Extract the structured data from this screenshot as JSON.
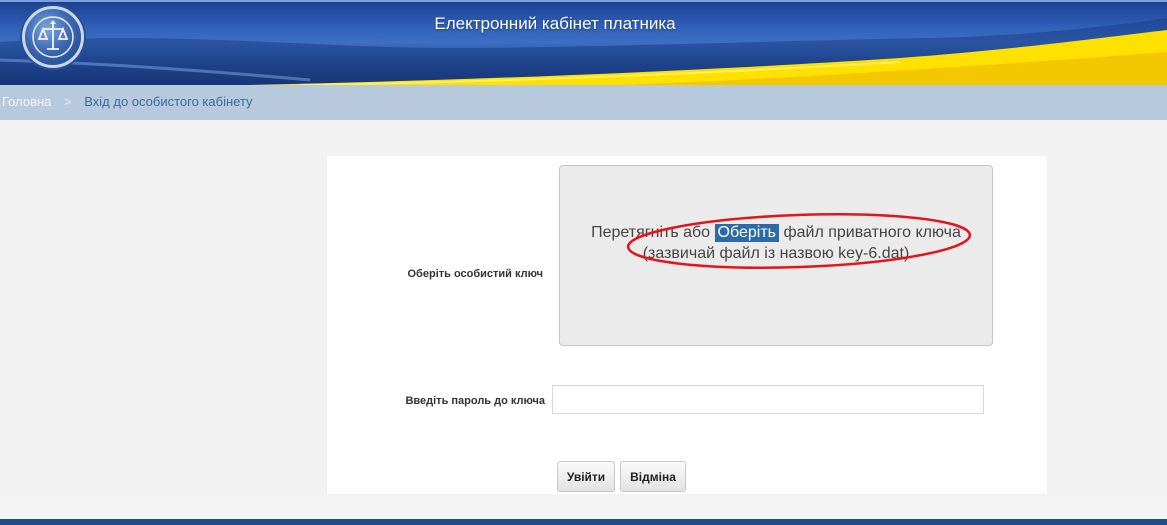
{
  "header": {
    "title": "Електронний кабінет платника",
    "flag_colors": {
      "blue": "#2f5fb8",
      "yellow": "#ffe100"
    },
    "emblem_icon": "tax-service-emblem-icon"
  },
  "breadcrumb": {
    "home": "Головна",
    "separator": ">",
    "current": "Вхід до особистого кабінету"
  },
  "form": {
    "key_label": "Оберіть особистий ключ",
    "dropzone": {
      "text_before": "Перетягніть або",
      "choose_link": "Оберіть",
      "text_after": "файл приватного ключа",
      "hint": "(зазвичай файл із назвою key-6.dat)"
    },
    "password_label": "Введіть пароль до ключа",
    "password_value": "",
    "buttons": {
      "login": "Увійти",
      "cancel": "Відміна"
    }
  },
  "annotation": {
    "color": "#e3141b",
    "icon": "red-ellipse-highlight"
  }
}
